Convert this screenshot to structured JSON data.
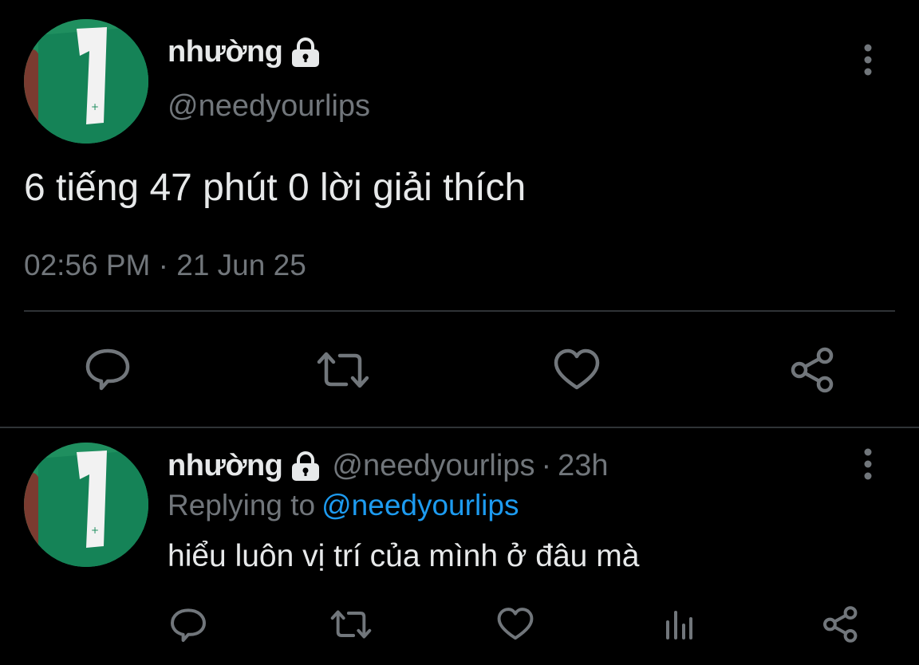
{
  "main_tweet": {
    "display_name": "nhường",
    "handle": "@needyourlips",
    "text": "6 tiếng 47 phút 0 lời giải thích",
    "timestamp": "02:56 PM · 21 Jun 25",
    "protected": true,
    "icons": [
      "lock-icon",
      "more-icon",
      "reply-icon",
      "retweet-icon",
      "like-icon",
      "share-icon"
    ]
  },
  "reply_tweet": {
    "display_name": "nhường",
    "handle": "@needyourlips",
    "separator": "·",
    "relative_time": "23h",
    "replying_prefix": "Replying to",
    "replying_to": "@needyourlips",
    "text": "hiểu luôn vị trí của mình ở đâu mà",
    "protected": true,
    "icons": [
      "lock-icon",
      "more-icon",
      "reply-icon",
      "retweet-icon",
      "like-icon",
      "analytics-icon",
      "share-icon"
    ]
  },
  "colors": {
    "background": "#000000",
    "primary_text": "#e7e9ea",
    "secondary_text": "#71767b",
    "accent": "#1d9bf0",
    "divider": "#2f3336"
  }
}
